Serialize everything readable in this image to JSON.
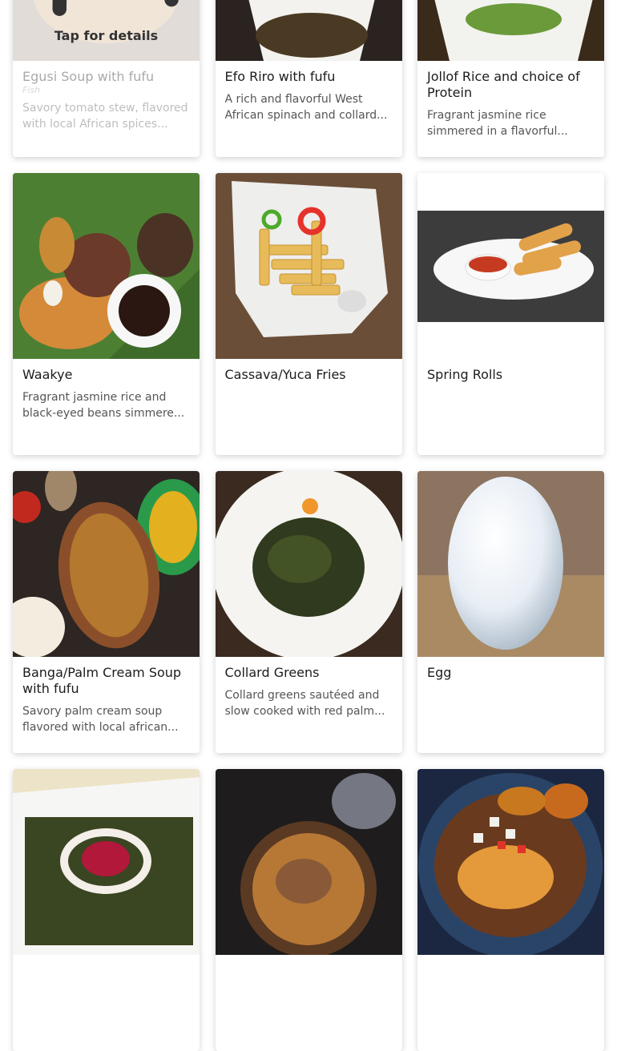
{
  "menu": {
    "overlay_label": "Tap for details",
    "items": [
      {
        "title": "Egusi Soup with fufu",
        "subtitle": "Fish",
        "desc": "Savory tomato stew, flavored with local African spices..."
      },
      {
        "title": "Efo Riro with fufu",
        "subtitle": "",
        "desc": "A rich and flavorful West African spinach and collard..."
      },
      {
        "title": "Jollof Rice and choice of Protein",
        "subtitle": "",
        "desc": "Fragrant jasmine rice simmered in a flavorful..."
      },
      {
        "title": "Waakye",
        "subtitle": "",
        "desc": "Fragrant jasmine rice and black-eyed beans simmere..."
      },
      {
        "title": "Cassava/Yuca Fries",
        "subtitle": "",
        "desc": ""
      },
      {
        "title": "Spring Rolls",
        "subtitle": "",
        "desc": ""
      },
      {
        "title": "Banga/Palm Cream Soup with fufu",
        "subtitle": "",
        "desc": "Savory palm cream soup flavored with local african..."
      },
      {
        "title": "Collard Greens",
        "subtitle": "",
        "desc": "Collard greens sautéed and slow cooked with red palm..."
      },
      {
        "title": "Egg",
        "subtitle": "",
        "desc": ""
      },
      {
        "title": "",
        "subtitle": "",
        "desc": ""
      },
      {
        "title": "",
        "subtitle": "",
        "desc": ""
      },
      {
        "title": "",
        "subtitle": "",
        "desc": ""
      }
    ]
  },
  "photo_icons": [
    "egusi-soup-photo",
    "efo-riro-photo",
    "jollof-rice-photo",
    "waakye-photo",
    "cassava-fries-photo",
    "spring-rolls-photo",
    "banga-soup-photo",
    "collard-greens-photo",
    "egg-photo",
    "greens-dish-photo",
    "goat-stew-photo",
    "gari-plantain-photo"
  ]
}
